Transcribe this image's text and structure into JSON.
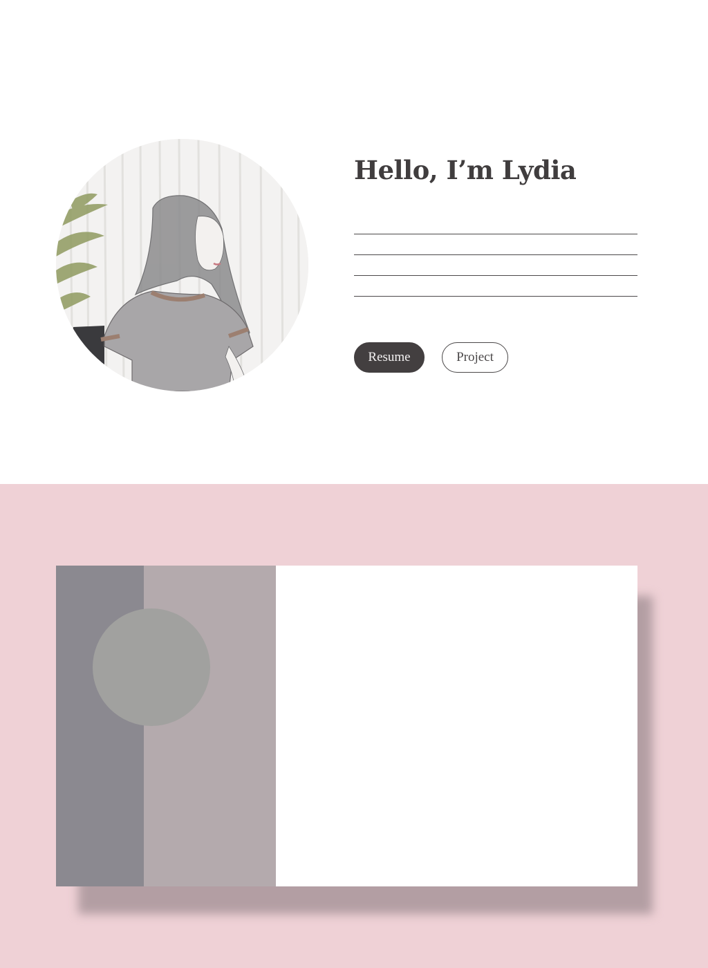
{
  "hero": {
    "title": "Hello, I’m Lydia",
    "portrait_icon": "portrait-illustration",
    "buttons": {
      "resume": "Resume",
      "project": "Project"
    }
  },
  "colors": {
    "hero_background": "#ffffff",
    "text_dark": "#403d3e",
    "button_filled": "#433f40",
    "pink_background": "#efd1d6",
    "card_shadow": "#b39ea3",
    "card_col_dark": "#8b8990",
    "card_col_mid": "#b4aaad",
    "card_circle": "#a1a19f"
  }
}
